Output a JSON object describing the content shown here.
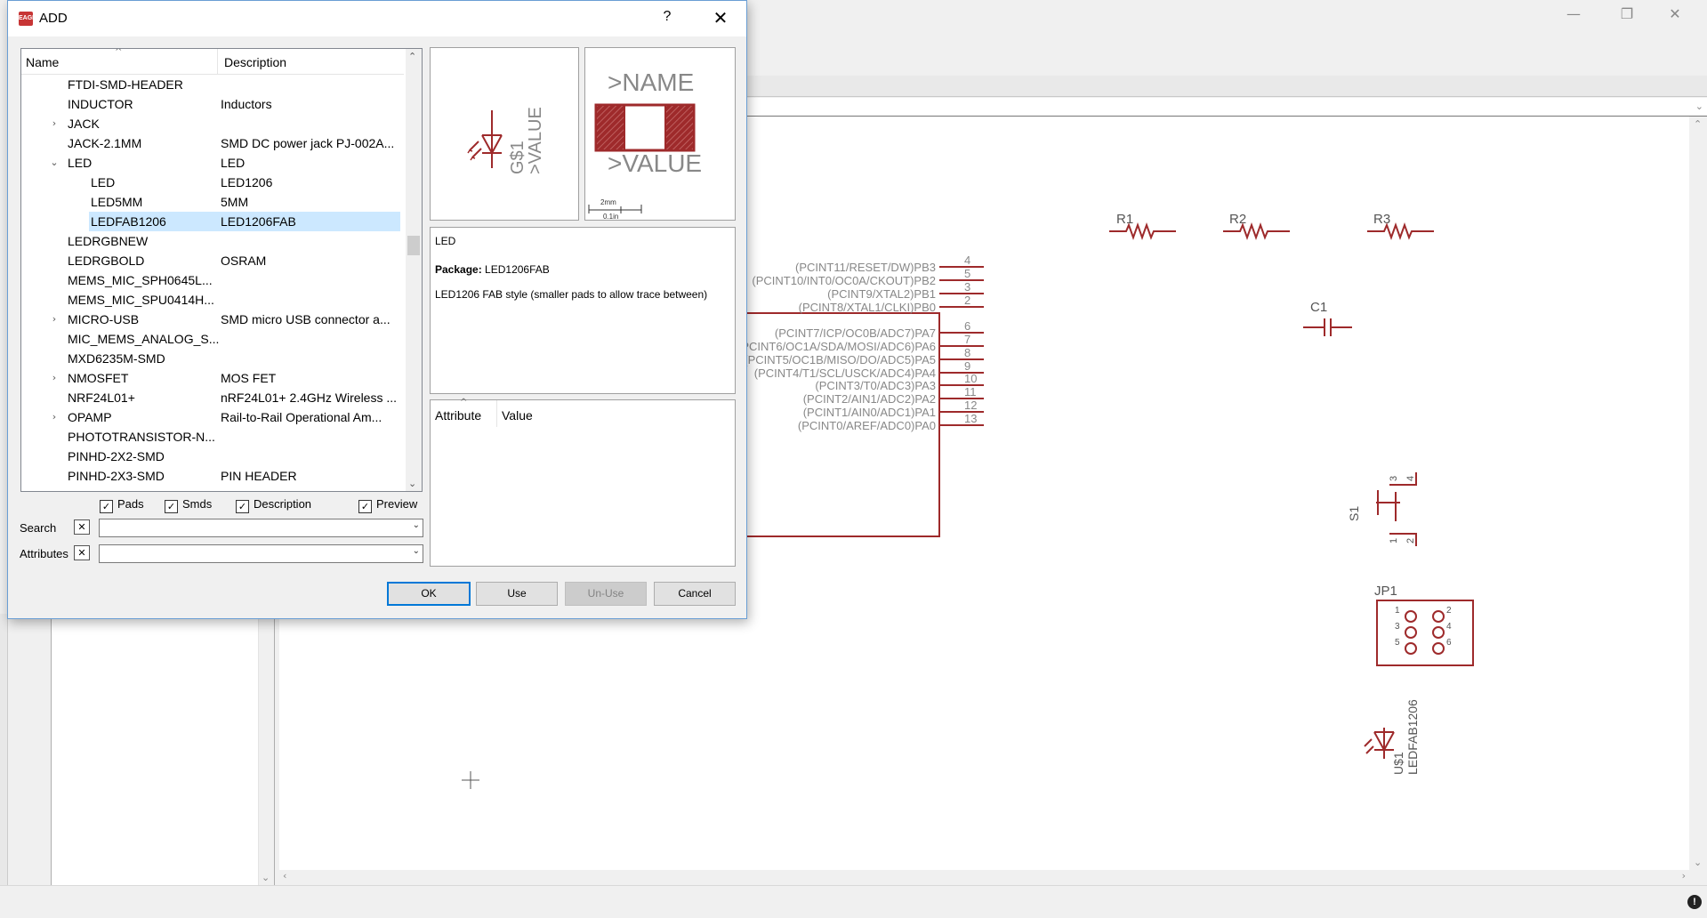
{
  "dialog": {
    "title": "ADD",
    "help_label": "?",
    "close_label": "✕",
    "app_icon_label": "EAGLE"
  },
  "tree": {
    "headers": {
      "name": "Name",
      "description": "Description"
    },
    "rows": [
      {
        "name": "FTDI-SMD-HEADER",
        "description": "",
        "level": 1,
        "expander": ""
      },
      {
        "name": "INDUCTOR",
        "description": "Inductors",
        "level": 1,
        "expander": ""
      },
      {
        "name": "JACK",
        "description": "",
        "level": 1,
        "expander": "›"
      },
      {
        "name": "JACK-2.1MM",
        "description": "SMD DC power jack PJ-002A...",
        "level": 1,
        "expander": ""
      },
      {
        "name": "LED",
        "description": "LED",
        "level": 1,
        "expander": "⌄"
      },
      {
        "name": "LED",
        "description": "LED1206",
        "level": 2,
        "expander": ""
      },
      {
        "name": "LED5MM",
        "description": "5MM",
        "level": 2,
        "expander": ""
      },
      {
        "name": "LEDFAB1206",
        "description": "LED1206FAB",
        "level": 2,
        "expander": "",
        "selected": true
      },
      {
        "name": "LEDRGBNEW",
        "description": "",
        "level": 1,
        "expander": ""
      },
      {
        "name": "LEDRGBOLD",
        "description": "OSRAM",
        "level": 1,
        "expander": ""
      },
      {
        "name": "MEMS_MIC_SPH0645L...",
        "description": "",
        "level": 1,
        "expander": ""
      },
      {
        "name": "MEMS_MIC_SPU0414H...",
        "description": "",
        "level": 1,
        "expander": ""
      },
      {
        "name": "MICRO-USB",
        "description": "SMD micro USB connector a...",
        "level": 1,
        "expander": "›"
      },
      {
        "name": "MIC_MEMS_ANALOG_S...",
        "description": "",
        "level": 1,
        "expander": ""
      },
      {
        "name": "MXD6235M-SMD",
        "description": "",
        "level": 1,
        "expander": ""
      },
      {
        "name": "NMOSFET",
        "description": "MOS FET",
        "level": 1,
        "expander": "›"
      },
      {
        "name": "NRF24L01+",
        "description": "nRF24L01+ 2.4GHz Wireless ...",
        "level": 1,
        "expander": ""
      },
      {
        "name": "OPAMP",
        "description": "Rail-to-Rail Operational Am...",
        "level": 1,
        "expander": "›"
      },
      {
        "name": "PHOTOTRANSISTOR-N...",
        "description": "",
        "level": 1,
        "expander": ""
      },
      {
        "name": "PINHD-2X2-SMD",
        "description": "",
        "level": 1,
        "expander": ""
      },
      {
        "name": "PINHD-2X3-SMD",
        "description": "PIN HEADER",
        "level": 1,
        "expander": ""
      }
    ]
  },
  "filters": {
    "pads": "Pads",
    "smds": "Smds",
    "description": "Description",
    "preview": "Preview",
    "checkmark": "✓"
  },
  "search": {
    "label": "Search",
    "value": ""
  },
  "attributes_field": {
    "label": "Attributes",
    "value": ""
  },
  "symbol_preview": {
    "name_ref": "G$1",
    "value_ref": ">VALUE"
  },
  "package_preview": {
    "name_label": ">NAME",
    "value_label": ">VALUE",
    "scale_mm": "2mm",
    "scale_in": "0.1in"
  },
  "description_panel": {
    "heading": "LED",
    "package_label": "Package:",
    "package_value": "LED1206FAB",
    "text": "LED1206 FAB style (smaller pads to allow trace between)"
  },
  "attributes_table": {
    "headers": {
      "attribute": "Attribute",
      "value": "Value"
    }
  },
  "buttons": {
    "ok": "OK",
    "use": "Use",
    "unuse": "Un-Use",
    "cancel": "Cancel"
  },
  "schematic": {
    "resistors": [
      "R1",
      "R2",
      "R3"
    ],
    "capacitor": "C1",
    "switch": "S1",
    "switch_pins": [
      "3",
      "4",
      "1",
      "2"
    ],
    "header": "JP1",
    "header_pins": [
      "1",
      "2",
      "3",
      "4",
      "5",
      "6"
    ],
    "led_name": "U$1",
    "led_value": "LEDFAB1206",
    "ic_pins": [
      {
        "label": "(PCINT11/RESET/DW)PB3",
        "num": "4"
      },
      {
        "label": "(PCINT10/INT0/OC0A/CKOUT)PB2",
        "num": "5"
      },
      {
        "label": "(PCINT9/XTAL2)PB1",
        "num": "3"
      },
      {
        "label": "(PCINT8/XTAL1/CLKI)PB0",
        "num": "2"
      },
      {
        "label": "(PCINT7/ICP/OC0B/ADC7)PA7",
        "num": "6"
      },
      {
        "label": "(PCINT6/OC1A/SDA/MOSI/ADC6)PA6",
        "num": "7"
      },
      {
        "label": "(PCINT5/OC1B/MISO/DO/ADC5)PA5",
        "num": "8"
      },
      {
        "label": "(PCINT4/T1/SCL/USCK/ADC4)PA4",
        "num": "9"
      },
      {
        "label": "(PCINT3/T0/ADC3)PA3",
        "num": "10"
      },
      {
        "label": "(PCINT2/AIN1/ADC2)PA2",
        "num": "11"
      },
      {
        "label": "(PCINT1/AIN0/ADC1)PA1",
        "num": "12"
      },
      {
        "label": "(PCINT0/AREF/ADC0)PA0",
        "num": "13"
      }
    ]
  },
  "window": {
    "minimize": "—",
    "restore": "❐",
    "close": "✕"
  },
  "colors": {
    "schematic": "#9e2a2b",
    "selection": "#cce8ff",
    "accent": "#0078d7"
  }
}
